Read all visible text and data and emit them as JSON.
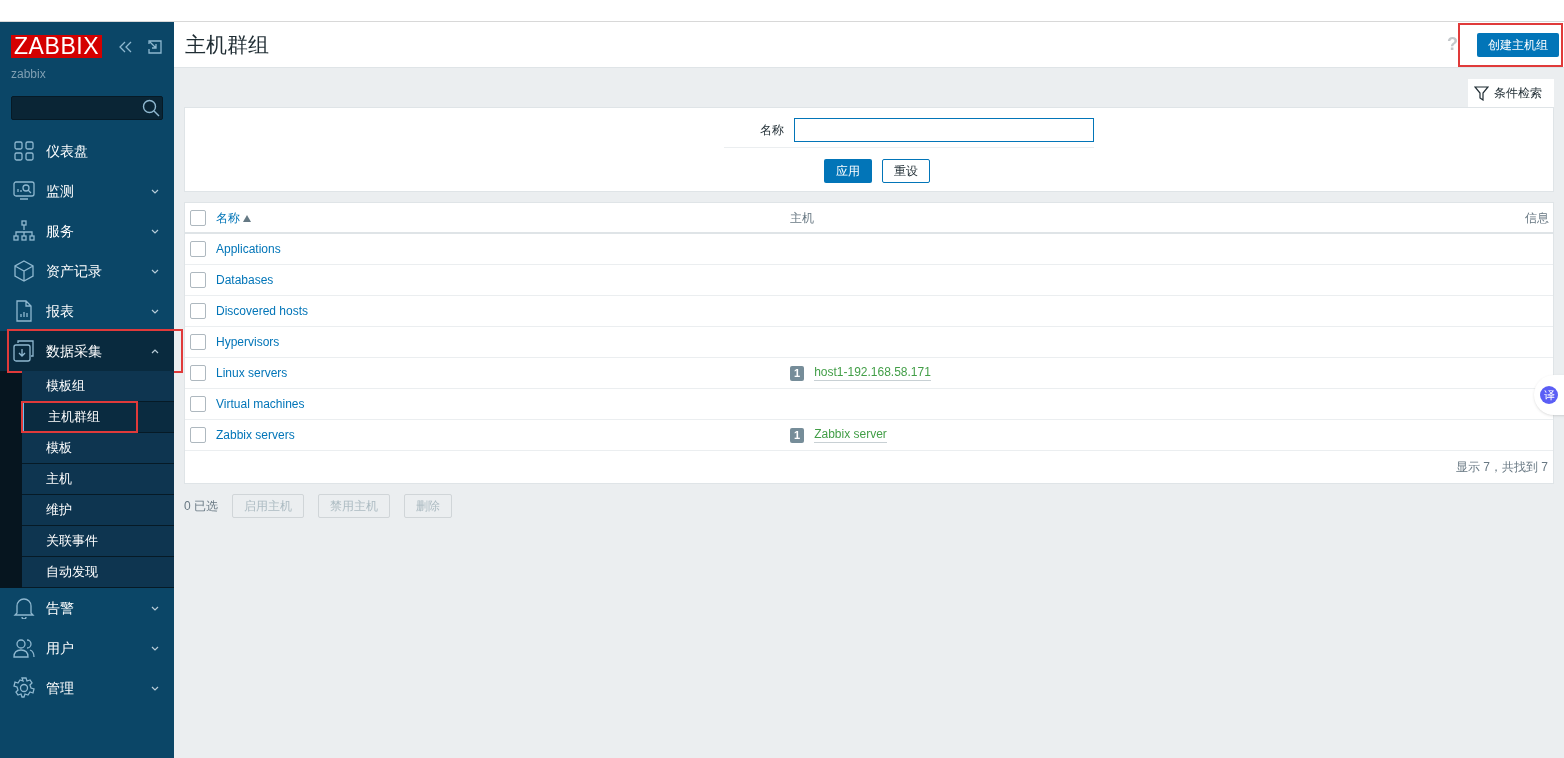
{
  "sidebar": {
    "logo": "ZABBIX",
    "user": "zabbix",
    "menu": [
      {
        "kind": "link",
        "label": "仪表盘",
        "marked": false
      },
      {
        "kind": "group",
        "label": "监测",
        "expanded": false,
        "marked": false
      },
      {
        "kind": "group",
        "label": "服务",
        "expanded": false,
        "marked": false
      },
      {
        "kind": "group",
        "label": "资产记录",
        "expanded": false,
        "marked": false
      },
      {
        "kind": "group",
        "label": "报表",
        "expanded": false,
        "marked": false
      },
      {
        "kind": "group",
        "label": "数据采集",
        "expanded": true,
        "marked": true,
        "children": [
          {
            "label": "模板组",
            "selected": false,
            "marked": false
          },
          {
            "label": "主机群组",
            "selected": true,
            "marked": true
          },
          {
            "label": "模板",
            "selected": false,
            "marked": false
          },
          {
            "label": "主机",
            "selected": false,
            "marked": false
          },
          {
            "label": "维护",
            "selected": false,
            "marked": false
          },
          {
            "label": "关联事件",
            "selected": false,
            "marked": false
          },
          {
            "label": "自动发现",
            "selected": false,
            "marked": false
          }
        ]
      },
      {
        "kind": "group",
        "label": "告警",
        "expanded": false,
        "marked": false
      },
      {
        "kind": "group",
        "label": "用户",
        "expanded": false,
        "marked": false
      },
      {
        "kind": "group",
        "label": "管理",
        "expanded": false,
        "marked": false
      }
    ]
  },
  "header": {
    "title": "主机群组",
    "help": "?",
    "create_button": {
      "label": "创建主机组",
      "marked": true
    }
  },
  "filter": {
    "tab": "条件检索",
    "name_label": "名称",
    "apply": "应用",
    "reset": "重设"
  },
  "table": {
    "columns": [
      "名称",
      "主机",
      "信息"
    ],
    "sorted_ascending": true,
    "all_checked": false,
    "rows": [
      {
        "name": "Applications",
        "checked": false,
        "hosts": []
      },
      {
        "name": "Databases",
        "checked": false,
        "hosts": []
      },
      {
        "name": "Discovered hosts",
        "checked": false,
        "hosts": []
      },
      {
        "name": "Hypervisors",
        "checked": false,
        "hosts": []
      },
      {
        "name": "Linux servers",
        "checked": false,
        "hosts": [
          {
            "count": "1",
            "name": "host1-192.168.58.171"
          }
        ]
      },
      {
        "name": "Virtual machines",
        "checked": false,
        "hosts": []
      },
      {
        "name": "Zabbix servers",
        "checked": false,
        "hosts": [
          {
            "count": "1",
            "name": "Zabbix server"
          }
        ]
      }
    ],
    "footer": "显示 7，共找到 7"
  },
  "actions": {
    "selected_count": "0 已选",
    "buttons": [
      "启用主机",
      "禁用主机",
      "删除"
    ]
  },
  "translate_widget": "译"
}
